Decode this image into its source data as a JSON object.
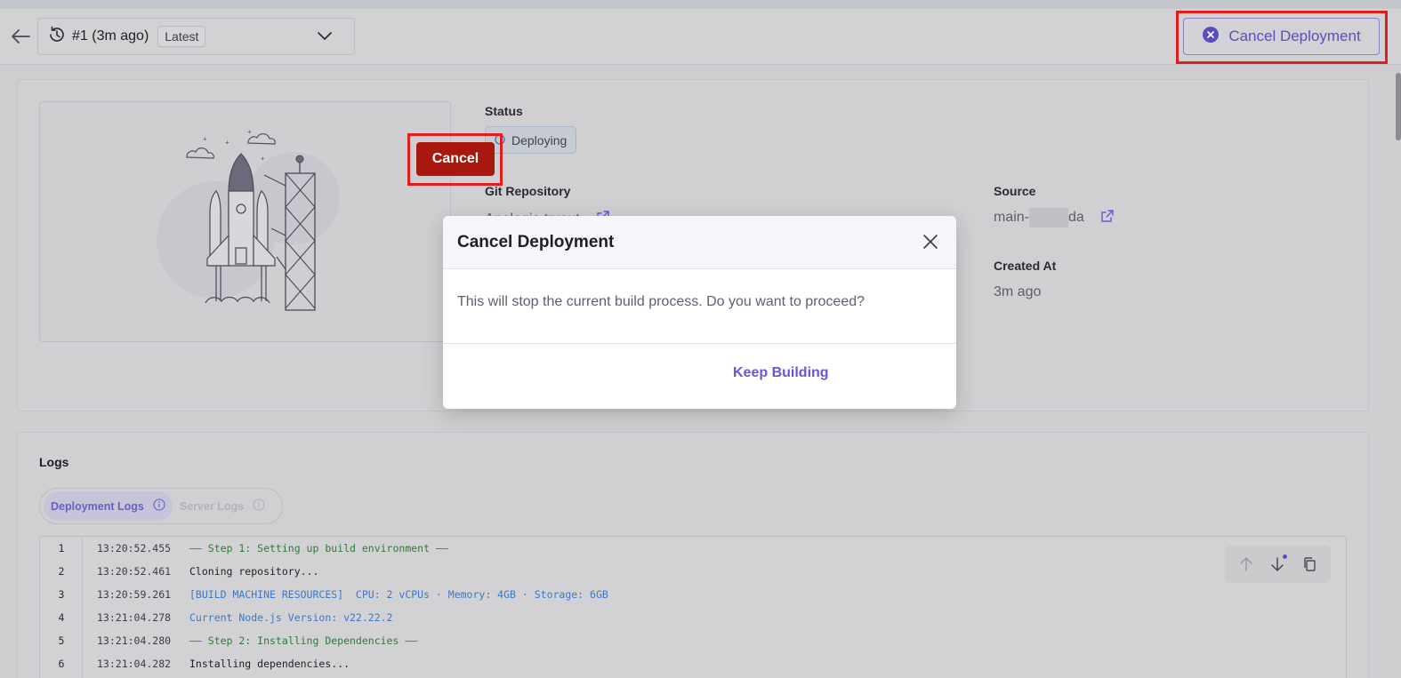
{
  "header": {
    "deployment_label": "#1 (3m ago)",
    "latest_badge": "Latest",
    "cancel_deployment_label": "Cancel Deployment"
  },
  "details": {
    "status_label": "Status",
    "status_value": "Deploying",
    "git_repo_label": "Git Repository",
    "git_repo_value": "Apologic-tryout",
    "source_label": "Source",
    "source_prefix": "main-",
    "source_suffix": "da",
    "created_at_label": "Created At",
    "created_at_value": "3m ago"
  },
  "logs": {
    "title": "Logs",
    "tabs": [
      {
        "label": "Deployment Logs",
        "active": true
      },
      {
        "label": "Server Logs",
        "active": false
      }
    ],
    "lines": [
      {
        "num": "1",
        "time": "13:20:52.455",
        "text": "—— Step 1: Setting up build environment ——",
        "color": "green"
      },
      {
        "num": "2",
        "time": "13:20:52.461",
        "text": "Cloning repository...",
        "color": "default"
      },
      {
        "num": "3",
        "time": "13:20:59.261",
        "text": "[BUILD MACHINE RESOURCES]  CPU: 2 vCPUs · Memory: 4GB · Storage: 6GB",
        "color": "blue"
      },
      {
        "num": "4",
        "time": "13:21:04.278",
        "text": "Current Node.js Version: v22.22.2",
        "color": "blue"
      },
      {
        "num": "5",
        "time": "13:21:04.280",
        "text": "—— Step 2: Installing Dependencies ——",
        "color": "green"
      },
      {
        "num": "6",
        "time": "13:21:04.282",
        "text": "Installing dependencies...",
        "color": "default"
      }
    ]
  },
  "modal": {
    "title": "Cancel Deployment",
    "message": "This will stop the current build process. Do you want to proceed?",
    "keep_label": "Keep Building",
    "cancel_label": "Cancel"
  },
  "colors": {
    "accent": "#5a4ec0",
    "danger": "#a8180f",
    "highlight": "#e21d1d"
  }
}
